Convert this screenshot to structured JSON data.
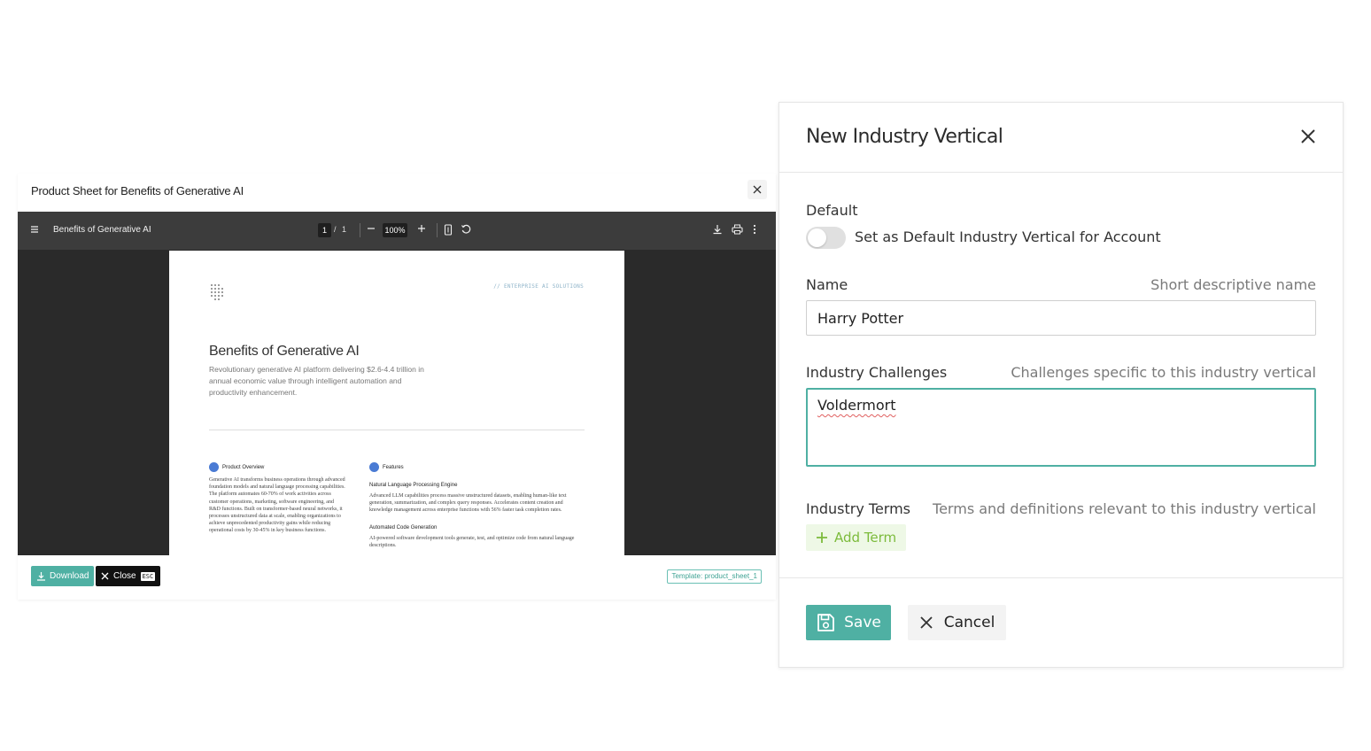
{
  "product_sheet": {
    "title": "Product Sheet for Benefits of Generative AI",
    "viewer": {
      "document_title": "Benefits of Generative AI",
      "current_page": "1",
      "page_separator": "/",
      "total_pages": "1",
      "zoom": "100%"
    },
    "page": {
      "tag": "// ENTERPRISE AI SOLUTIONS",
      "title": "Benefits of Generative AI",
      "subtitle": "Revolutionary generative AI platform delivering $2.6-4.4 trillion in annual economic value through intelligent automation and productivity enhancement.",
      "overview_heading": "Product Overview",
      "overview_body": "Generative AI transforms business operations through advanced foundation models and natural language processing capabilities. The platform automates 60-70% of work activities across customer operations, marketing, software engineering, and R&D functions. Built on transformer-based neural networks, it processes unstructured data at scale, enabling organizations to achieve unprecedented productivity gains while reducing operational costs by 30-45% in key business functions.",
      "features_heading": "Features",
      "feature1_title": "Natural Language Processing Engine",
      "feature1_body": "Advanced LLM capabilities process massive unstructured datasets, enabling human-like text generation, summarization, and complex query responses. Accelerates content creation and knowledge management across enterprise functions with 56% faster task completion rates.",
      "feature2_title": "Automated Code Generation",
      "feature2_body": "AI-powered software development tools generate, test, and optimize code from natural language descriptions."
    },
    "footer": {
      "download_label": "Download",
      "close_label": "Close",
      "esc_label": "ESC",
      "template_label": "Template: product_sheet_1"
    }
  },
  "drawer": {
    "title": "New Industry Vertical",
    "default_label": "Default",
    "default_toggle_label": "Set as Default Industry Vertical for Account",
    "default_on": false,
    "name_label": "Name",
    "name_hint": "Short descriptive name",
    "name_value": "Harry Potter",
    "challenges_label": "Industry Challenges",
    "challenges_hint": "Challenges specific to this industry vertical",
    "challenges_value": "Voldermort",
    "terms_label": "Industry Terms",
    "terms_hint": "Terms and definitions relevant to this industry vertical",
    "add_term_label": "Add Term",
    "save_label": "Save",
    "cancel_label": "Cancel"
  },
  "colors": {
    "accent": "#4fb0a3",
    "add_term_text": "#7cbb3c",
    "viewer_bg": "#2a2a2a",
    "viewer_bar": "#3c3c3c"
  },
  "icons": {
    "sheet_close": "close-icon",
    "viewer_menu": "hamburger-menu-icon",
    "fit_page": "fit-page-icon",
    "rotate": "rotate-icon",
    "viewer_download": "download-icon",
    "print": "print-icon",
    "more": "more-vertical-icon",
    "drawer_close": "close-icon",
    "add_term": "plus-icon",
    "save": "floppy-disk-icon",
    "cancel": "close-icon"
  }
}
